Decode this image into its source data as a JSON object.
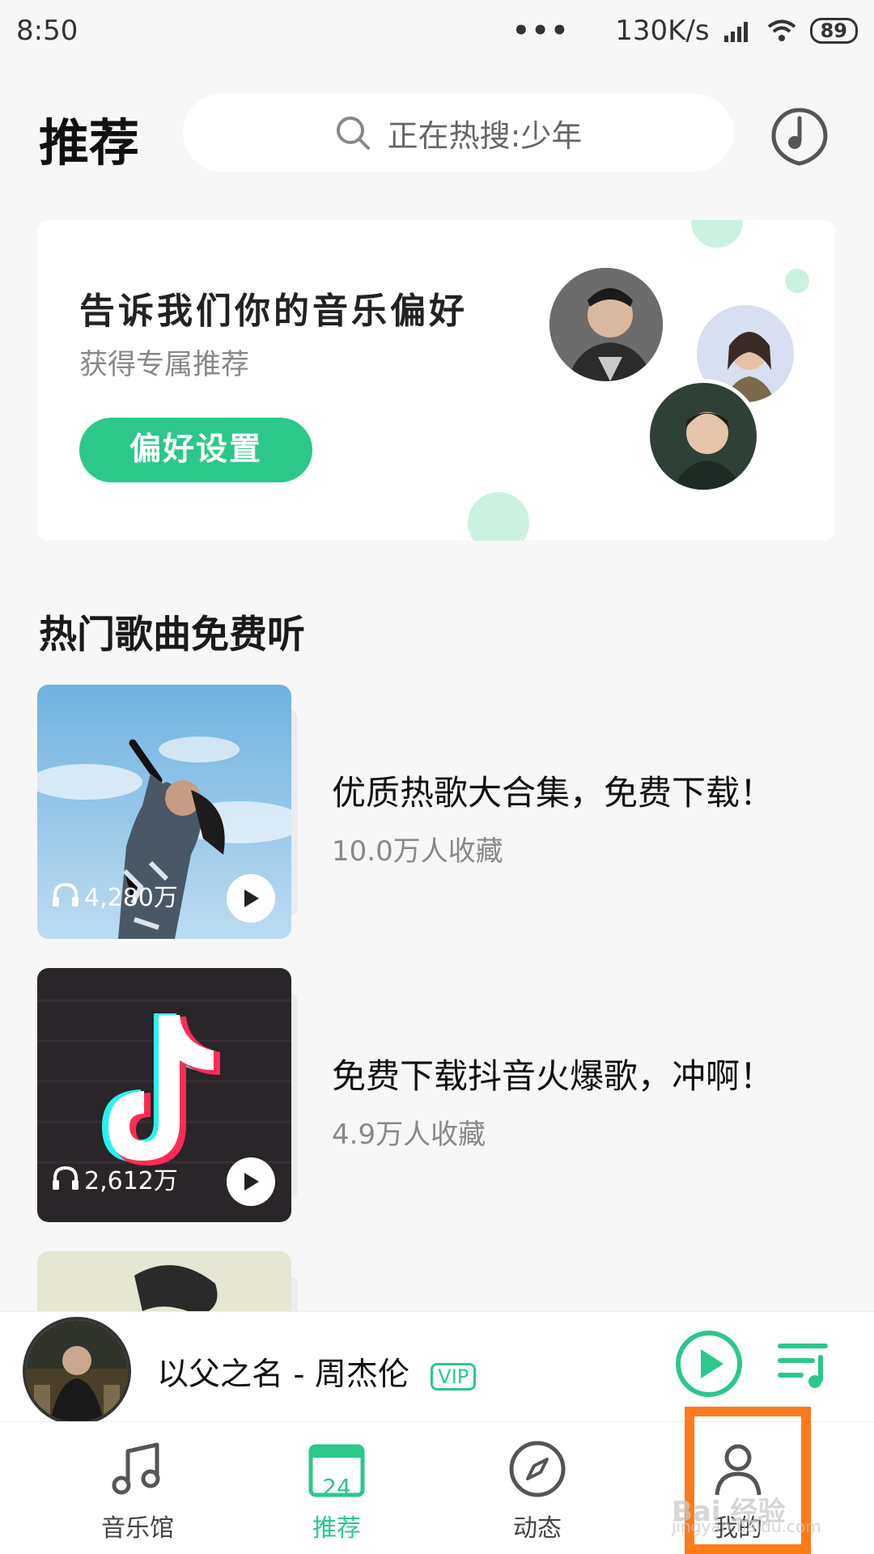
{
  "status": {
    "time": "8:50",
    "dots": "•••",
    "speed": "130K/s",
    "battery": "89"
  },
  "header": {
    "title": "推荐",
    "search_placeholder": "正在热搜:少年"
  },
  "banner": {
    "title": "告诉我们你的音乐偏好",
    "subtitle": "获得专属推荐",
    "button": "偏好设置"
  },
  "section": {
    "title": "热门歌曲免费听"
  },
  "playlists": [
    {
      "title": "优质热歌大合集，免费下载！",
      "meta": "10.0万人收藏",
      "plays": "4,280万"
    },
    {
      "title": "免费下载抖音火爆歌，冲啊！",
      "meta": "4.9万人收藏",
      "plays": "2,612万"
    }
  ],
  "mini_player": {
    "title": "以父之名 - 周杰伦",
    "badge": "VIP"
  },
  "tabs": [
    {
      "label": "音乐馆",
      "icon": "music-note-icon"
    },
    {
      "label": "推荐",
      "icon": "calendar-icon",
      "badge": "24"
    },
    {
      "label": "动态",
      "icon": "compass-icon"
    },
    {
      "label": "我的",
      "icon": "user-icon"
    }
  ],
  "watermark": {
    "text": "Bai 经验",
    "url": "jingyan.baidu.com"
  },
  "colors": {
    "accent": "#2bc88a",
    "highlight": "#ff7a18"
  }
}
